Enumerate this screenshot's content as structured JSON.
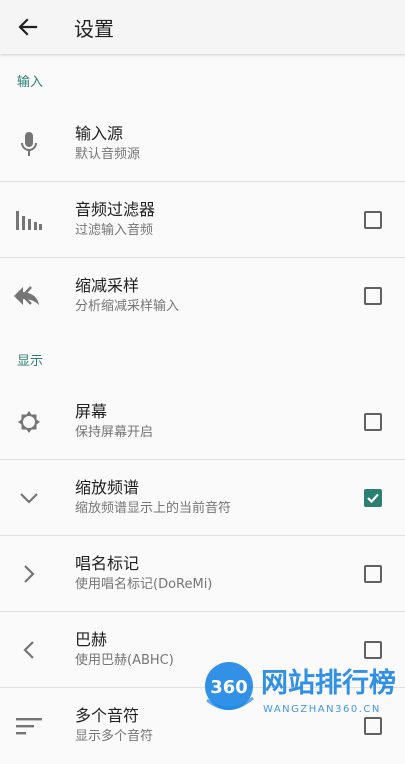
{
  "header": {
    "title": "设置"
  },
  "sections": {
    "input": "输入",
    "display": "显示"
  },
  "items": [
    {
      "title": "输入源",
      "subtitle": "默认音频源"
    },
    {
      "title": "音频过滤器",
      "subtitle": "过滤输入音频",
      "checked": false
    },
    {
      "title": "缩减采样",
      "subtitle": "分析缩减采样输入",
      "checked": false
    },
    {
      "title": "屏幕",
      "subtitle": "保持屏幕开启",
      "checked": false
    },
    {
      "title": "缩放频谱",
      "subtitle": "缩放频谱显示上的当前音符",
      "checked": true
    },
    {
      "title": "唱名标记",
      "subtitle": "使用唱名标记(DoReMi)",
      "checked": false
    },
    {
      "title": "巴赫",
      "subtitle": "使用巴赫(ABHC)",
      "checked": false
    },
    {
      "title": "多个音符",
      "subtitle": "显示多个音符",
      "checked": false
    }
  ],
  "watermark": {
    "badge": "360",
    "name": "网站排行榜",
    "url": "WANGZHAN360.CN"
  },
  "colors": {
    "accent": "#2b7f73"
  }
}
